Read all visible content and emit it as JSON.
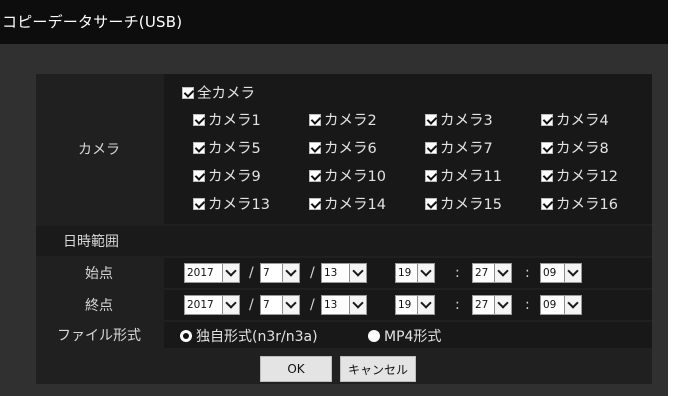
{
  "window": {
    "title": "コピーデータサーチ(USB)"
  },
  "camera": {
    "label": "カメラ",
    "all": {
      "label": "全カメラ",
      "checked": true
    },
    "items": [
      {
        "label": "カメラ1",
        "checked": true
      },
      {
        "label": "カメラ2",
        "checked": true
      },
      {
        "label": "カメラ3",
        "checked": true
      },
      {
        "label": "カメラ4",
        "checked": true
      },
      {
        "label": "カメラ5",
        "checked": true
      },
      {
        "label": "カメラ6",
        "checked": true
      },
      {
        "label": "カメラ7",
        "checked": true
      },
      {
        "label": "カメラ8",
        "checked": true
      },
      {
        "label": "カメラ9",
        "checked": true
      },
      {
        "label": "カメラ10",
        "checked": true
      },
      {
        "label": "カメラ11",
        "checked": true
      },
      {
        "label": "カメラ12",
        "checked": true
      },
      {
        "label": "カメラ13",
        "checked": true
      },
      {
        "label": "カメラ14",
        "checked": true
      },
      {
        "label": "カメラ15",
        "checked": true
      },
      {
        "label": "カメラ16",
        "checked": true
      }
    ]
  },
  "datetime_range": {
    "label": "日時範囲"
  },
  "separators": {
    "date": "/",
    "time": ":"
  },
  "start": {
    "label": "始点",
    "year": "2017",
    "month": "7",
    "day": "13",
    "hour": "19",
    "minute": "27",
    "second": "09"
  },
  "end": {
    "label": "終点",
    "year": "2017",
    "month": "7",
    "day": "13",
    "hour": "19",
    "minute": "27",
    "second": "09"
  },
  "file_format": {
    "label": "ファイル形式",
    "options": [
      {
        "label": "独自形式(n3r/n3a)",
        "selected": true
      },
      {
        "label": "MP4形式",
        "selected": false
      }
    ]
  },
  "buttons": {
    "ok": "OK",
    "cancel": "キャンセル"
  },
  "icons": {
    "checkbox": "checkbox-checked-icon",
    "dropdown": "chevron-down-icon",
    "radio": "radio-icon"
  }
}
